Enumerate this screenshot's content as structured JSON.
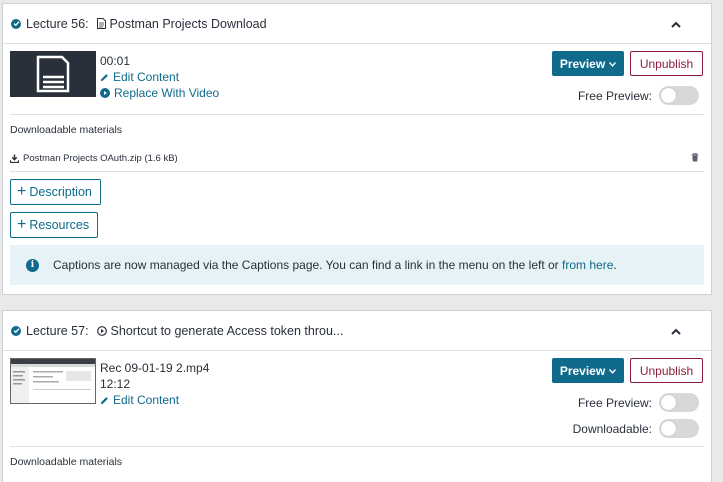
{
  "lectures": [
    {
      "prefix": "Lecture 56:",
      "title": "Postman Projects Download",
      "kind_icon": "document-icon",
      "duration": "00:01",
      "edit_label": "Edit Content",
      "replace_label": "Replace With Video",
      "preview_label": "Preview",
      "unpublish_label": "Unpublish",
      "free_preview_label": "Free Preview:",
      "free_preview_on": false,
      "downloadable_title": "Downloadable materials",
      "download_file": "Postman Projects OAuth.zip (1.6 kB)",
      "description_label": "Description",
      "resources_label": "Resources",
      "info_text": "Captions are now managed via the Captions page. You can find a link in the menu on the left or ",
      "info_link": "from here",
      "info_tail": "."
    },
    {
      "prefix": "Lecture 57:",
      "title": "Shortcut to generate Access token throu...",
      "kind_icon": "play-icon",
      "file_name": "Rec 09-01-19 2.mp4",
      "duration": "12:12",
      "edit_label": "Edit Content",
      "preview_label": "Preview",
      "unpublish_label": "Unpublish",
      "free_preview_label": "Free Preview:",
      "free_preview_on": false,
      "downloadable_label": "Downloadable:",
      "downloadable_on": false,
      "downloadable_title": "Downloadable materials"
    }
  ],
  "colors": {
    "accent": "#0f6a8c",
    "unpublish": "#8c1d3a",
    "info_bg": "#e6f2f5"
  }
}
